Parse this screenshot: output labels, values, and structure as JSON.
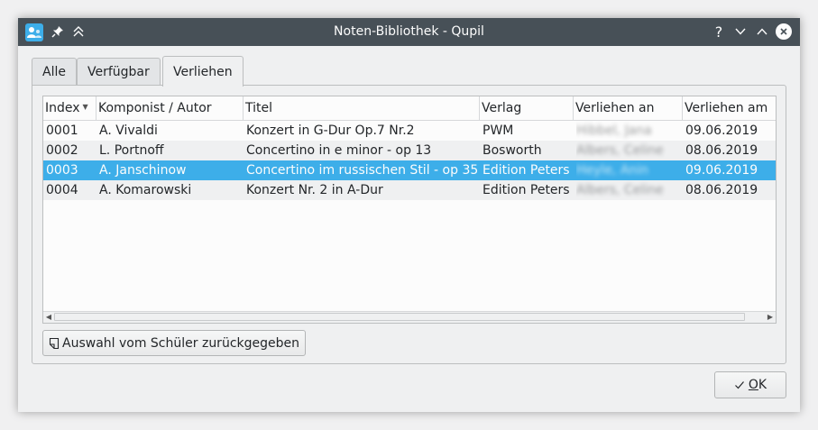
{
  "window": {
    "title": "Noten-Bibliothek - Qupil",
    "help_glyph": "?"
  },
  "tabs": [
    {
      "label": "Alle",
      "active": false
    },
    {
      "label": "Verfügbar",
      "active": false
    },
    {
      "label": "Verliehen",
      "active": true
    }
  ],
  "table": {
    "columns": [
      "Index",
      "Komponist / Autor",
      "Titel",
      "Verlag",
      "Verliehen an",
      "Verliehen am"
    ],
    "sorted_column": "Index",
    "rows": [
      {
        "index": "0001",
        "composer": "A. Vivaldi",
        "title": "Konzert in G-Dur Op.7 Nr.2",
        "publisher": "PWM",
        "lent_to": "Hibbel, Jana",
        "lent_on": "09.06.2019"
      },
      {
        "index": "0002",
        "composer": "L. Portnoff",
        "title": "Concertino in e minor - op 13",
        "publisher": "Bosworth",
        "lent_to": "Albers, Celine",
        "lent_on": "08.06.2019"
      },
      {
        "index": "0003",
        "composer": "A. Janschinow",
        "title": "Concertino im russischen Stil - op 35",
        "publisher": "Edition Peters",
        "lent_to": "Heyle, Anin",
        "lent_on": "09.06.2019"
      },
      {
        "index": "0004",
        "composer": "A. Komarowski",
        "title": "Konzert Nr. 2 in A-Dur",
        "publisher": "Edition Peters",
        "lent_to": "Albers, Celine",
        "lent_on": "08.06.2019"
      }
    ],
    "selected_row_index": 2
  },
  "buttons": {
    "return_label": "Auswahl vom Schüler zurückgegeben",
    "ok_label": "OK"
  },
  "colors": {
    "titlebar": "#475057",
    "selection": "#3daee9",
    "accent": "#3daee9"
  }
}
